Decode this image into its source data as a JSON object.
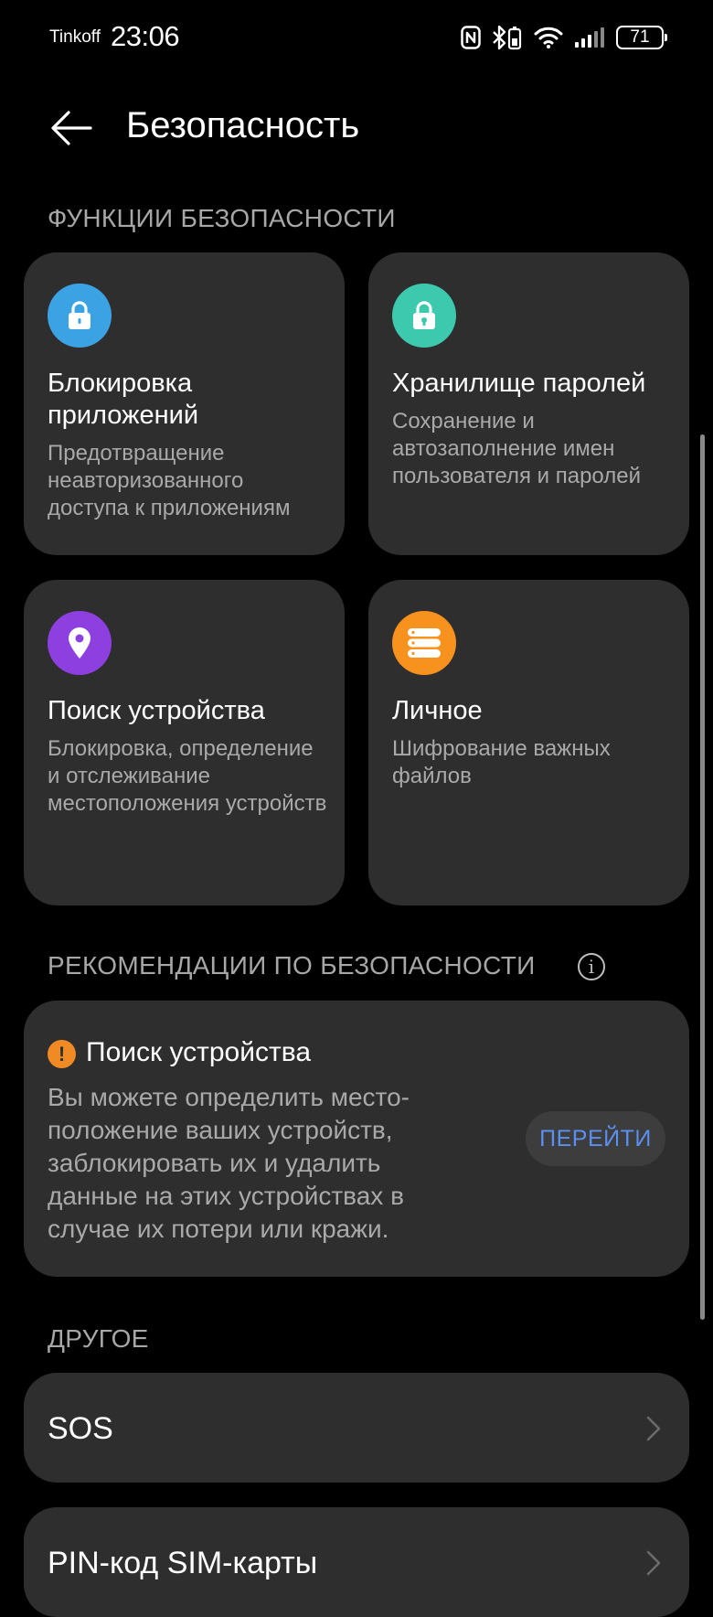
{
  "status_bar": {
    "carrier": "Tinkoff",
    "time": "23:06",
    "battery": "71",
    "icons": [
      "nfc-icon",
      "bluetooth-icon",
      "wifi-icon",
      "signal-icon",
      "battery-icon"
    ]
  },
  "header": {
    "title": "Безопасность",
    "back_icon": "arrow-left-icon"
  },
  "sections": {
    "features": "ФУНКЦИИ БЕЗОПАСНОСТИ",
    "recommendations": "РЕКОМЕНДАЦИИ ПО БЕЗОПАСНОСТИ",
    "other": "ДРУГОЕ"
  },
  "features": [
    {
      "title": "Блокировка приложений",
      "desc": "Предотвращение неавторизованного доступа к приложениям",
      "icon": "lock-icon",
      "color": "#3ba3e4"
    },
    {
      "title": "Хранилище паролей",
      "desc": "Сохранение и автозаполнение имен пользователя и паролей",
      "icon": "keyhole-lock-icon",
      "color": "#3dc9ae"
    },
    {
      "title": "Поиск устройства",
      "desc": "Блокировка, определение и отслеживание местоположения устройств",
      "icon": "location-pin-icon",
      "color": "#8e3fe0"
    },
    {
      "title": "Личное",
      "desc": "Шифрование важных файлов",
      "icon": "storage-icon",
      "color": "#f7921e"
    }
  ],
  "recommendation": {
    "title": "Поиск устройства",
    "desc": "Вы можете определить место-положение ваших устройств, заблокировать их и удалить данные на этих устройствах в случае их потери или кражи.",
    "button": "ПЕРЕЙТИ",
    "warning_color": "#f08a24",
    "button_text_color": "#5b8ff0"
  },
  "other_items": [
    {
      "label": "SOS"
    },
    {
      "label": "PIN-код SIM-карты"
    }
  ]
}
